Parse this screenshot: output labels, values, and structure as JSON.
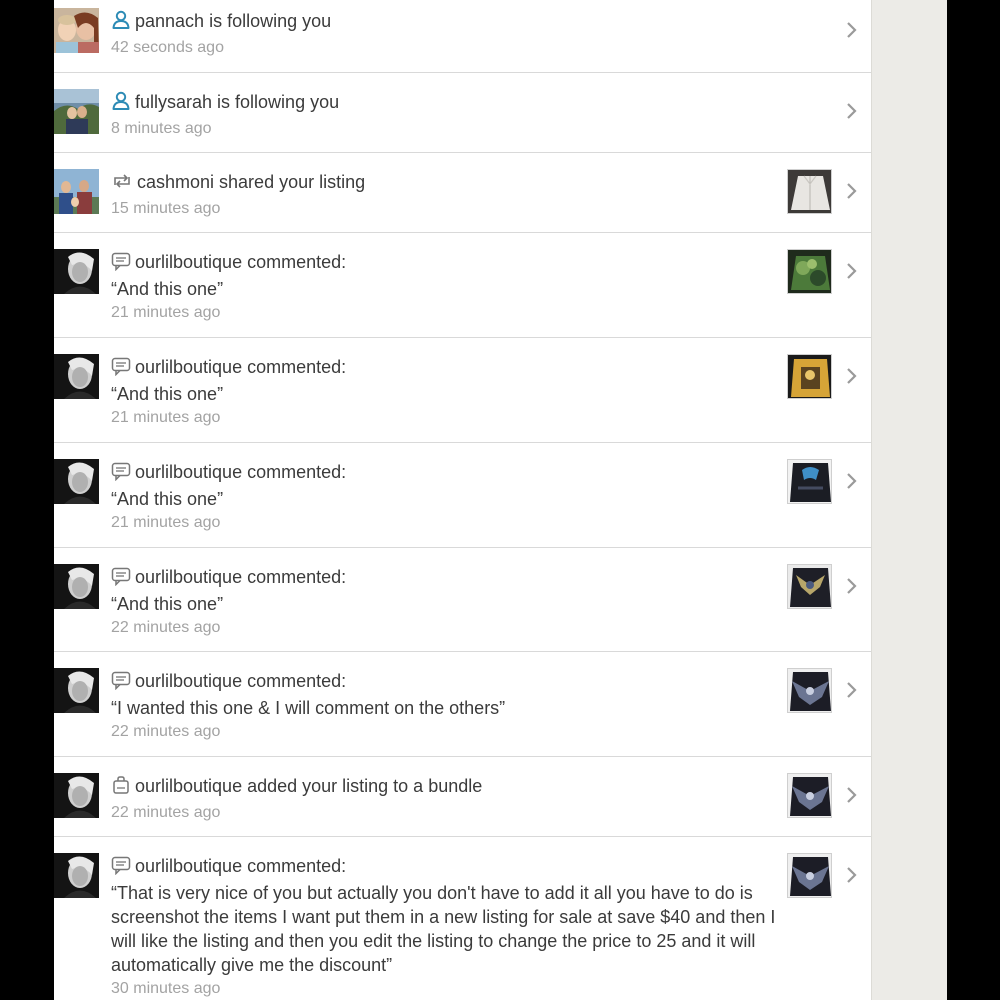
{
  "notifications": [
    {
      "type": "follow",
      "message": "pannach is following you",
      "quote": "",
      "time": "42 seconds ago",
      "has_thumb": false,
      "avatar": "couple-avatar",
      "thumb": "",
      "colors": {
        "icon": "#2d8bb5"
      }
    },
    {
      "type": "follow",
      "message": "fullysarah is following you",
      "quote": "",
      "time": "8 minutes ago",
      "has_thumb": false,
      "avatar": "outdoor-avatar",
      "thumb": "",
      "colors": {
        "icon": "#2d8bb5"
      }
    },
    {
      "type": "share",
      "message": "cashmoni shared your listing",
      "quote": "",
      "time": "15 minutes ago",
      "has_thumb": true,
      "avatar": "family-avatar",
      "thumb": "white-jacket"
    },
    {
      "type": "comment",
      "message": "ourlilboutique commented:",
      "quote": "“And this one”",
      "time": "21 minutes ago",
      "has_thumb": true,
      "avatar": "bw-avatar",
      "thumb": "green-tie-dye-shirt"
    },
    {
      "type": "comment",
      "message": "ourlilboutique commented:",
      "quote": "“And this one”",
      "time": "21 minutes ago",
      "has_thumb": true,
      "avatar": "bw-avatar",
      "thumb": "yellow-graphic-shirt"
    },
    {
      "type": "comment",
      "message": "ourlilboutique commented:",
      "quote": "“And this one”",
      "time": "21 minutes ago",
      "has_thumb": true,
      "avatar": "bw-avatar",
      "thumb": "black-blue-shirt"
    },
    {
      "type": "comment",
      "message": "ourlilboutique commented:",
      "quote": "“And this one”",
      "time": "22 minutes ago",
      "has_thumb": true,
      "avatar": "bw-avatar",
      "thumb": "black-gold-shirt"
    },
    {
      "type": "comment",
      "message": "ourlilboutique commented:",
      "quote": "“I wanted this one & I will comment on the others”",
      "time": "22 minutes ago",
      "has_thumb": true,
      "avatar": "bw-avatar",
      "thumb": "black-eagle-shirt"
    },
    {
      "type": "bundle",
      "message": "ourlilboutique added your listing to a bundle",
      "quote": "",
      "time": "22 minutes ago",
      "has_thumb": true,
      "avatar": "bw-avatar",
      "thumb": "black-eagle-shirt-2"
    },
    {
      "type": "comment",
      "message": "ourlilboutique commented:",
      "quote": "“That is very nice of you but actually you don't have to add it all you have to do is screenshot the items I want put them in a new listing for sale at save $40 and then I will like the listing and then you edit the listing to change the price to 25 and it will automatically give me the discount”",
      "time": "30 minutes ago",
      "has_thumb": true,
      "avatar": "bw-avatar",
      "thumb": "black-eagle-shirt-3"
    }
  ],
  "icons": {
    "follow": "person-icon",
    "share": "share-icon",
    "comment": "comment-bubble-icon",
    "bundle": "bundle-bag-icon",
    "chevron": "chevron-right-icon"
  },
  "colors": {
    "follow_icon": "#2d8bb5",
    "activity_icon": "#777777",
    "text": "#3b3b3b",
    "time": "#a3a3a3",
    "divider": "#d9d9d9"
  }
}
